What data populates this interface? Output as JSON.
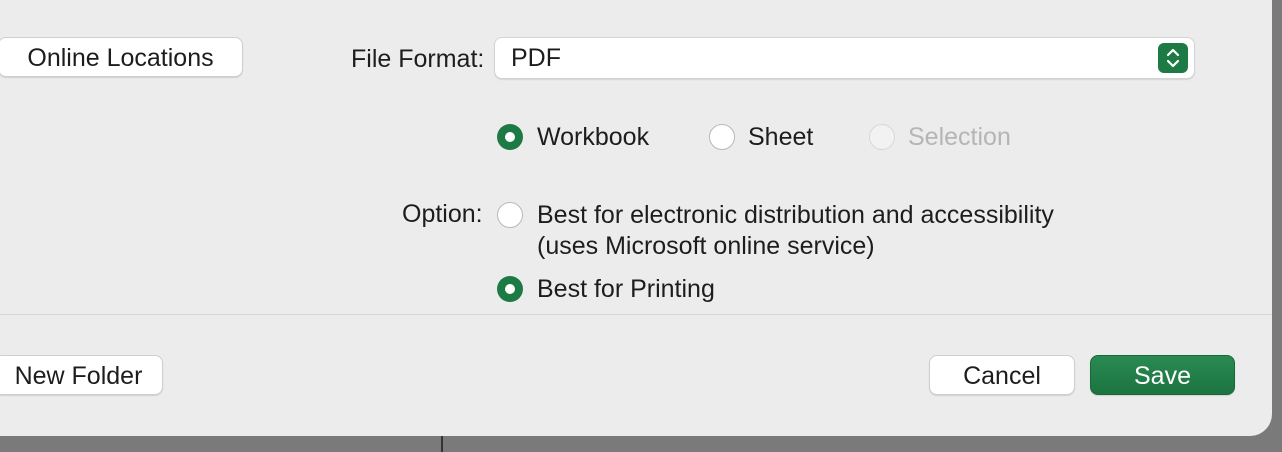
{
  "sidebar": {
    "online_locations_label": "Online Locations"
  },
  "file_format": {
    "label": "File Format:",
    "value": "PDF"
  },
  "scope": {
    "workbook_label": "Workbook",
    "sheet_label": "Sheet",
    "selection_label": "Selection",
    "selected": "Workbook"
  },
  "option": {
    "label": "Option:",
    "electronic_line1": "Best for electronic distribution and accessibility",
    "electronic_line2": "(uses Microsoft online service)",
    "printing_label": "Best for Printing",
    "selected": "Best for Printing"
  },
  "footer": {
    "new_folder_label": "New Folder",
    "cancel_label": "Cancel",
    "save_label": "Save"
  },
  "colors": {
    "accent": "#1e7a45",
    "dialog_bg": "#ececec"
  }
}
